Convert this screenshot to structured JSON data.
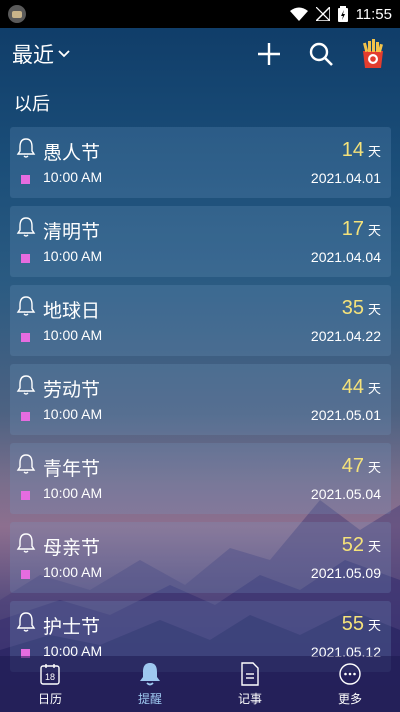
{
  "status_bar": {
    "time": "11:55"
  },
  "app_bar": {
    "title": "最近",
    "icons": [
      "plus-icon",
      "search-icon",
      "gift-box-icon"
    ]
  },
  "section": {
    "title": "以后"
  },
  "reminders": [
    {
      "name": "愚人节",
      "time": "10:00 AM",
      "days": "14",
      "unit": "天",
      "date": "2021.04.01"
    },
    {
      "name": "清明节",
      "time": "10:00 AM",
      "days": "17",
      "unit": "天",
      "date": "2021.04.04"
    },
    {
      "name": "地球日",
      "time": "10:00 AM",
      "days": "35",
      "unit": "天",
      "date": "2021.04.22"
    },
    {
      "name": "劳动节",
      "time": "10:00 AM",
      "days": "44",
      "unit": "天",
      "date": "2021.05.01"
    },
    {
      "name": "青年节",
      "time": "10:00 AM",
      "days": "47",
      "unit": "天",
      "date": "2021.05.04"
    },
    {
      "name": "母亲节",
      "time": "10:00 AM",
      "days": "52",
      "unit": "天",
      "date": "2021.05.09"
    },
    {
      "name": "护士节",
      "time": "10:00 AM",
      "days": "55",
      "unit": "天",
      "date": "2021.05.12"
    }
  ],
  "bottom_nav": [
    {
      "label": "日历",
      "icon": "calendar-icon",
      "badge": "18",
      "active": false
    },
    {
      "label": "提醒",
      "icon": "bell-icon",
      "active": true
    },
    {
      "label": "记事",
      "icon": "note-icon",
      "active": false
    },
    {
      "label": "更多",
      "icon": "more-icon",
      "active": false
    }
  ],
  "colors": {
    "days_highlight": "#f5e27a",
    "marker": "#e66ce0",
    "active_nav": "#9ec8f0"
  }
}
